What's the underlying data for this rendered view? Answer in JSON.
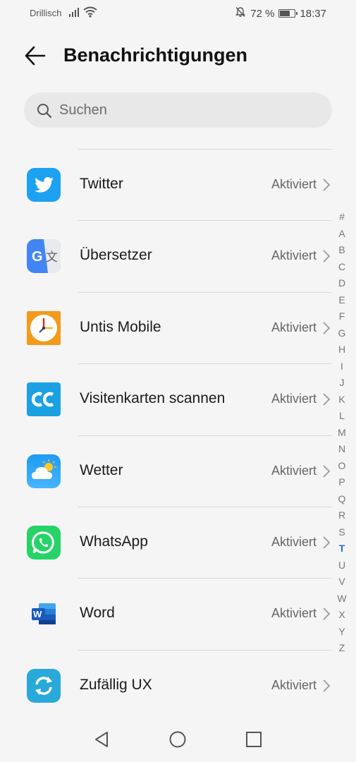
{
  "status_bar": {
    "carrier": "Drillisch",
    "battery_text": "72 %",
    "battery_level": 0.72,
    "time": "18:37"
  },
  "header": {
    "title": "Benachrichtigungen"
  },
  "search": {
    "placeholder": "Suchen"
  },
  "apps": [
    {
      "name": "Twitter",
      "status": "Aktiviert",
      "icon": "twitter-icon"
    },
    {
      "name": "Übersetzer",
      "status": "Aktiviert",
      "icon": "translate-icon"
    },
    {
      "name": "Untis Mobile",
      "status": "Aktiviert",
      "icon": "clock-icon"
    },
    {
      "name": "Visitenkarten scannen",
      "status": "Aktiviert",
      "icon": "camcard-icon"
    },
    {
      "name": "Wetter",
      "status": "Aktiviert",
      "icon": "weather-icon"
    },
    {
      "name": "WhatsApp",
      "status": "Aktiviert",
      "icon": "whatsapp-icon"
    },
    {
      "name": "Word",
      "status": "Aktiviert",
      "icon": "word-icon"
    },
    {
      "name": "Zufällig UX",
      "status": "Aktiviert",
      "icon": "sync-icon"
    }
  ],
  "index_letters": [
    "#",
    "A",
    "B",
    "C",
    "D",
    "E",
    "F",
    "G",
    "H",
    "I",
    "J",
    "K",
    "L",
    "M",
    "N",
    "O",
    "P",
    "Q",
    "R",
    "S",
    "T",
    "U",
    "V",
    "W",
    "X",
    "Y",
    "Z"
  ],
  "index_active": "T",
  "colors": {
    "accent": "#2a6fd6",
    "twitter": "#1da1f2",
    "whatsapp": "#25d366",
    "word": "#185abd",
    "camcard": "#1ba1e2"
  }
}
